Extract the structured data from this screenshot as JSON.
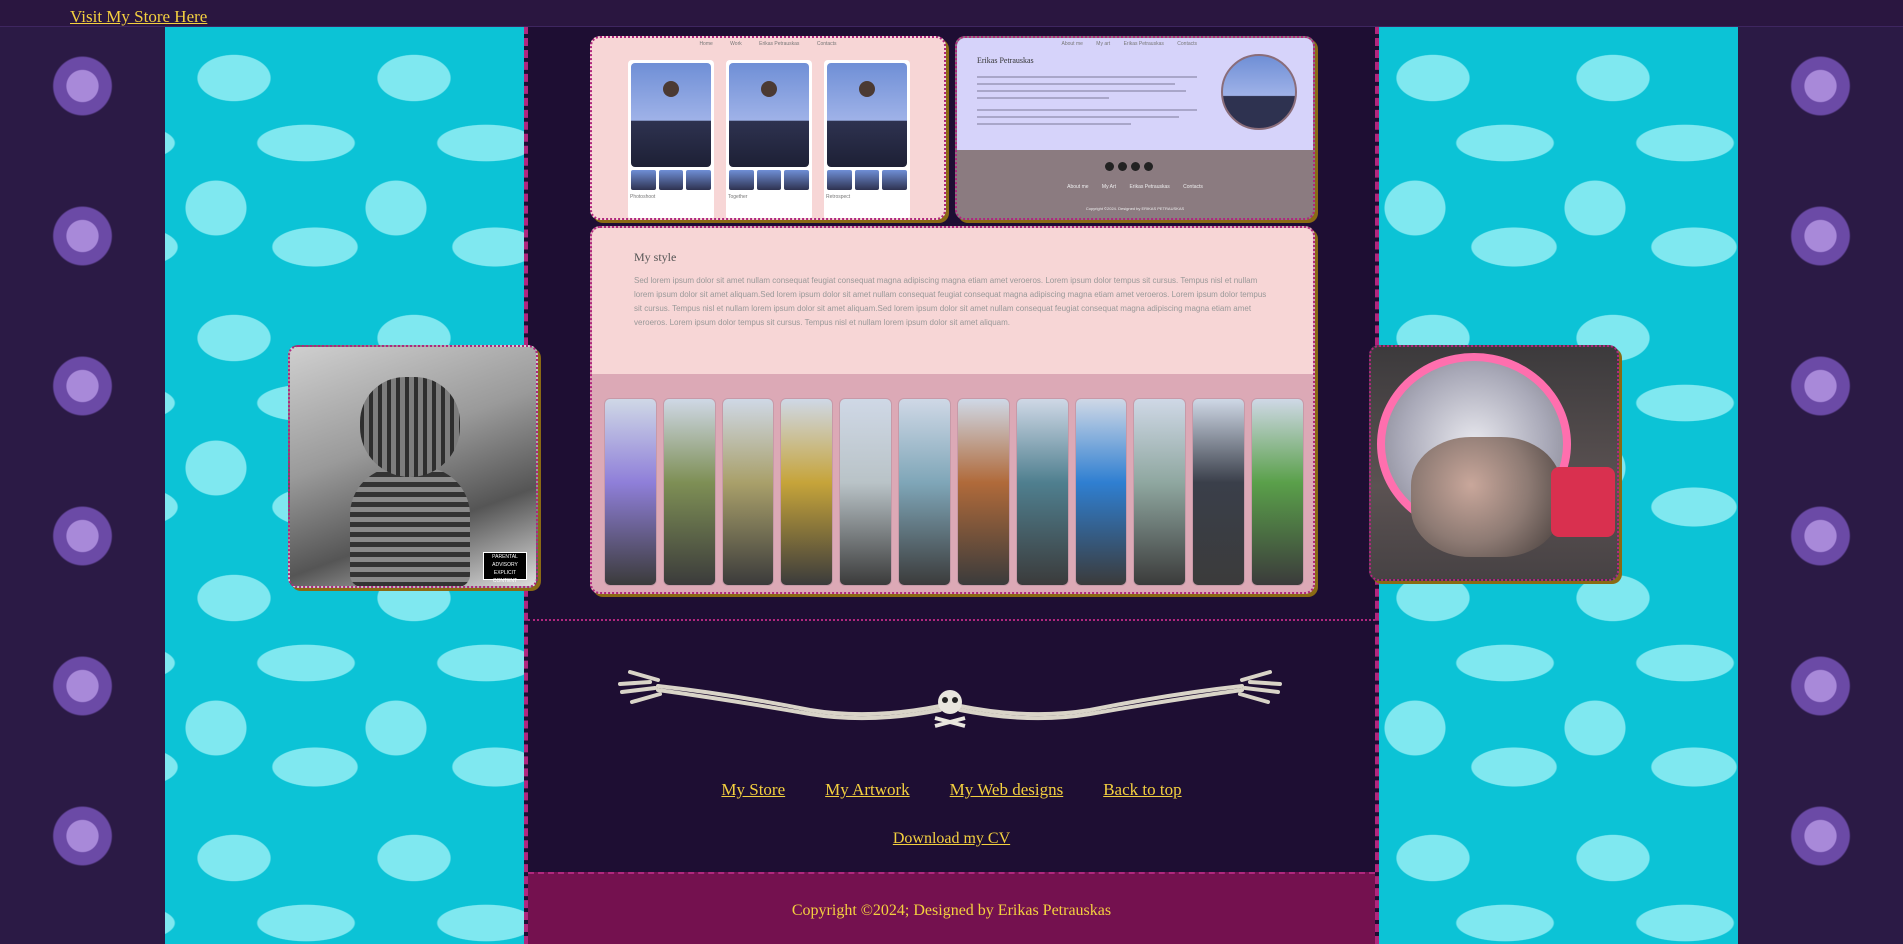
{
  "topbar": {
    "store_link": "Visit My Store Here"
  },
  "web_design_1": {
    "nav": [
      "Home",
      "Work",
      "Erikas Petrauskas",
      "Contacts"
    ],
    "cards": [
      {
        "caption": "Photoshoot"
      },
      {
        "caption": "Together"
      },
      {
        "caption": "Retrospect"
      }
    ]
  },
  "web_design_2": {
    "nav": [
      "About me",
      "My art",
      "Erikas Petrauskas",
      "Contacts"
    ],
    "name": "Erikas Petrauskas",
    "footer_links": [
      "About me",
      "My Art",
      "Erikas Petrauskas",
      "Contacts"
    ],
    "copyright": "Copyright ©2024. Designed by ERIKAS PETRAUSKAS"
  },
  "my_style": {
    "title": "My style",
    "body": "Sed lorem ipsum dolor sit amet nullam consequat feugiat consequat magna adipiscing magna etiam amet veroeros. Lorem ipsum dolor tempus sit cursus. Tempus nisl et nullam lorem ipsum dolor sit amet aliquam.Sed lorem ipsum dolor sit amet nullam consequat feugiat consequat magna adipiscing magna etiam amet veroeros. Lorem ipsum dolor tempus sit cursus. Tempus nisl et nullam lorem ipsum dolor sit amet aliquam.Sed lorem ipsum dolor sit amet nullam consequat feugiat consequat magna adipiscing magna etiam amet veroeros. Lorem ipsum dolor tempus sit cursus. Tempus nisl et nullam lorem ipsum dolor sit amet aliquam.",
    "strip_colors": [
      "#8f7fd9",
      "#7e8f55",
      "#a9a06a",
      "#c6a43a",
      "#b9c3c7",
      "#7fa6b8",
      "#b06a3a",
      "#4f7f8f",
      "#2f7fd1",
      "#8fa7a0",
      "#3a3f4a",
      "#5aa04a"
    ]
  },
  "cat_advisory": "PARENTAL ADVISORY EXPLICIT CONTENT",
  "footer_links": {
    "store": "My Store",
    "artwork": "My Artwork",
    "web_designs": "My Web designs",
    "back_to_top": "Back to top",
    "cv": "Download my CV"
  },
  "copyright": "Copyright ©2024; Designed by Erikas Petrauskas",
  "colors": {
    "accent_link": "#f4d03f",
    "border_pink": "#b0277e",
    "footer_bg": "#74114f",
    "page_bg": "#1e0e33"
  }
}
